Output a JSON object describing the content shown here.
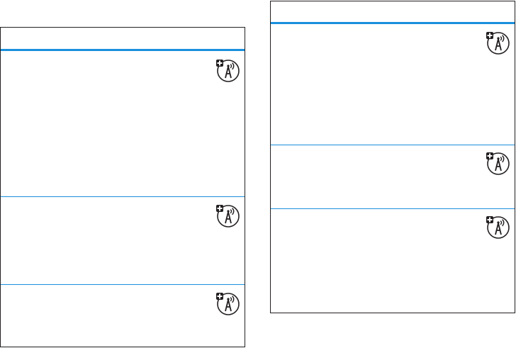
{
  "tables": [
    {
      "header": "",
      "rows": [
        {
          "text": "",
          "icon": "network-feature-icon"
        },
        {
          "text": "",
          "icon": "network-feature-icon"
        },
        {
          "text": "",
          "icon": "network-feature-icon"
        }
      ]
    },
    {
      "header": "",
      "rows": [
        {
          "text": "",
          "icon": "network-feature-icon"
        },
        {
          "text": "",
          "icon": "network-feature-icon"
        },
        {
          "text": "",
          "icon": "network-feature-icon"
        }
      ]
    }
  ],
  "colors": {
    "accent_rule": "#1a8fdc",
    "border": "#231f20"
  }
}
